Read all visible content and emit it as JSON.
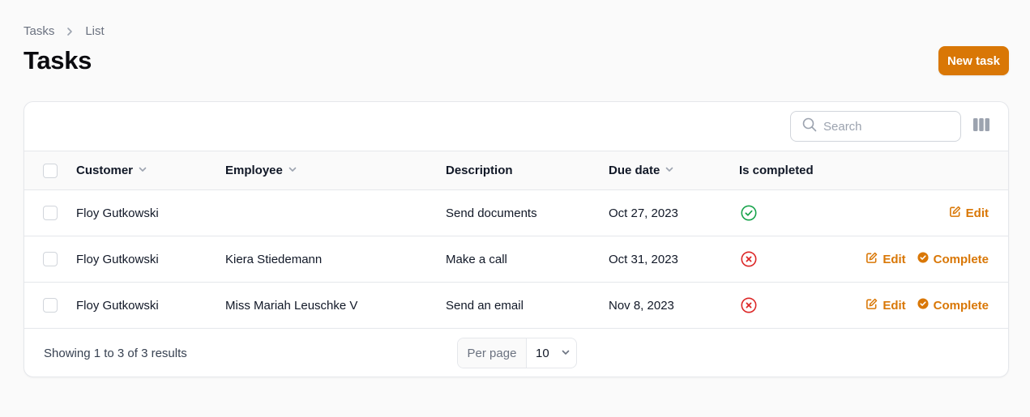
{
  "breadcrumb": {
    "items": [
      "Tasks",
      "List"
    ]
  },
  "page": {
    "title": "Tasks"
  },
  "header": {
    "new_button_label": "New task"
  },
  "colors": {
    "accent": "#d97706",
    "success": "#16a34a",
    "danger": "#dc2626"
  },
  "toolbar": {
    "search_placeholder": "Search",
    "search_icon": "search-icon",
    "columns_icon": "columns-icon"
  },
  "table": {
    "columns": [
      "Customer",
      "Employee",
      "Description",
      "Due date",
      "Is completed"
    ],
    "rows": [
      {
        "customer": "Floy Gutkowski",
        "employee": "",
        "description": "Send documents",
        "due_date": "Oct 27, 2023",
        "completed": true,
        "edit_label": "Edit",
        "complete_label": ""
      },
      {
        "customer": "Floy Gutkowski",
        "employee": "Kiera Stiedemann",
        "description": "Make a call",
        "due_date": "Oct 31, 2023",
        "completed": false,
        "edit_label": "Edit",
        "complete_label": "Complete"
      },
      {
        "customer": "Floy Gutkowski",
        "employee": "Miss Mariah Leuschke V",
        "description": "Send an email",
        "due_date": "Nov 8, 2023",
        "completed": false,
        "edit_label": "Edit",
        "complete_label": "Complete"
      }
    ]
  },
  "footer": {
    "showing_text": "Showing 1 to 3 of 3 results",
    "per_page_label": "Per page",
    "per_page_value": "10"
  }
}
